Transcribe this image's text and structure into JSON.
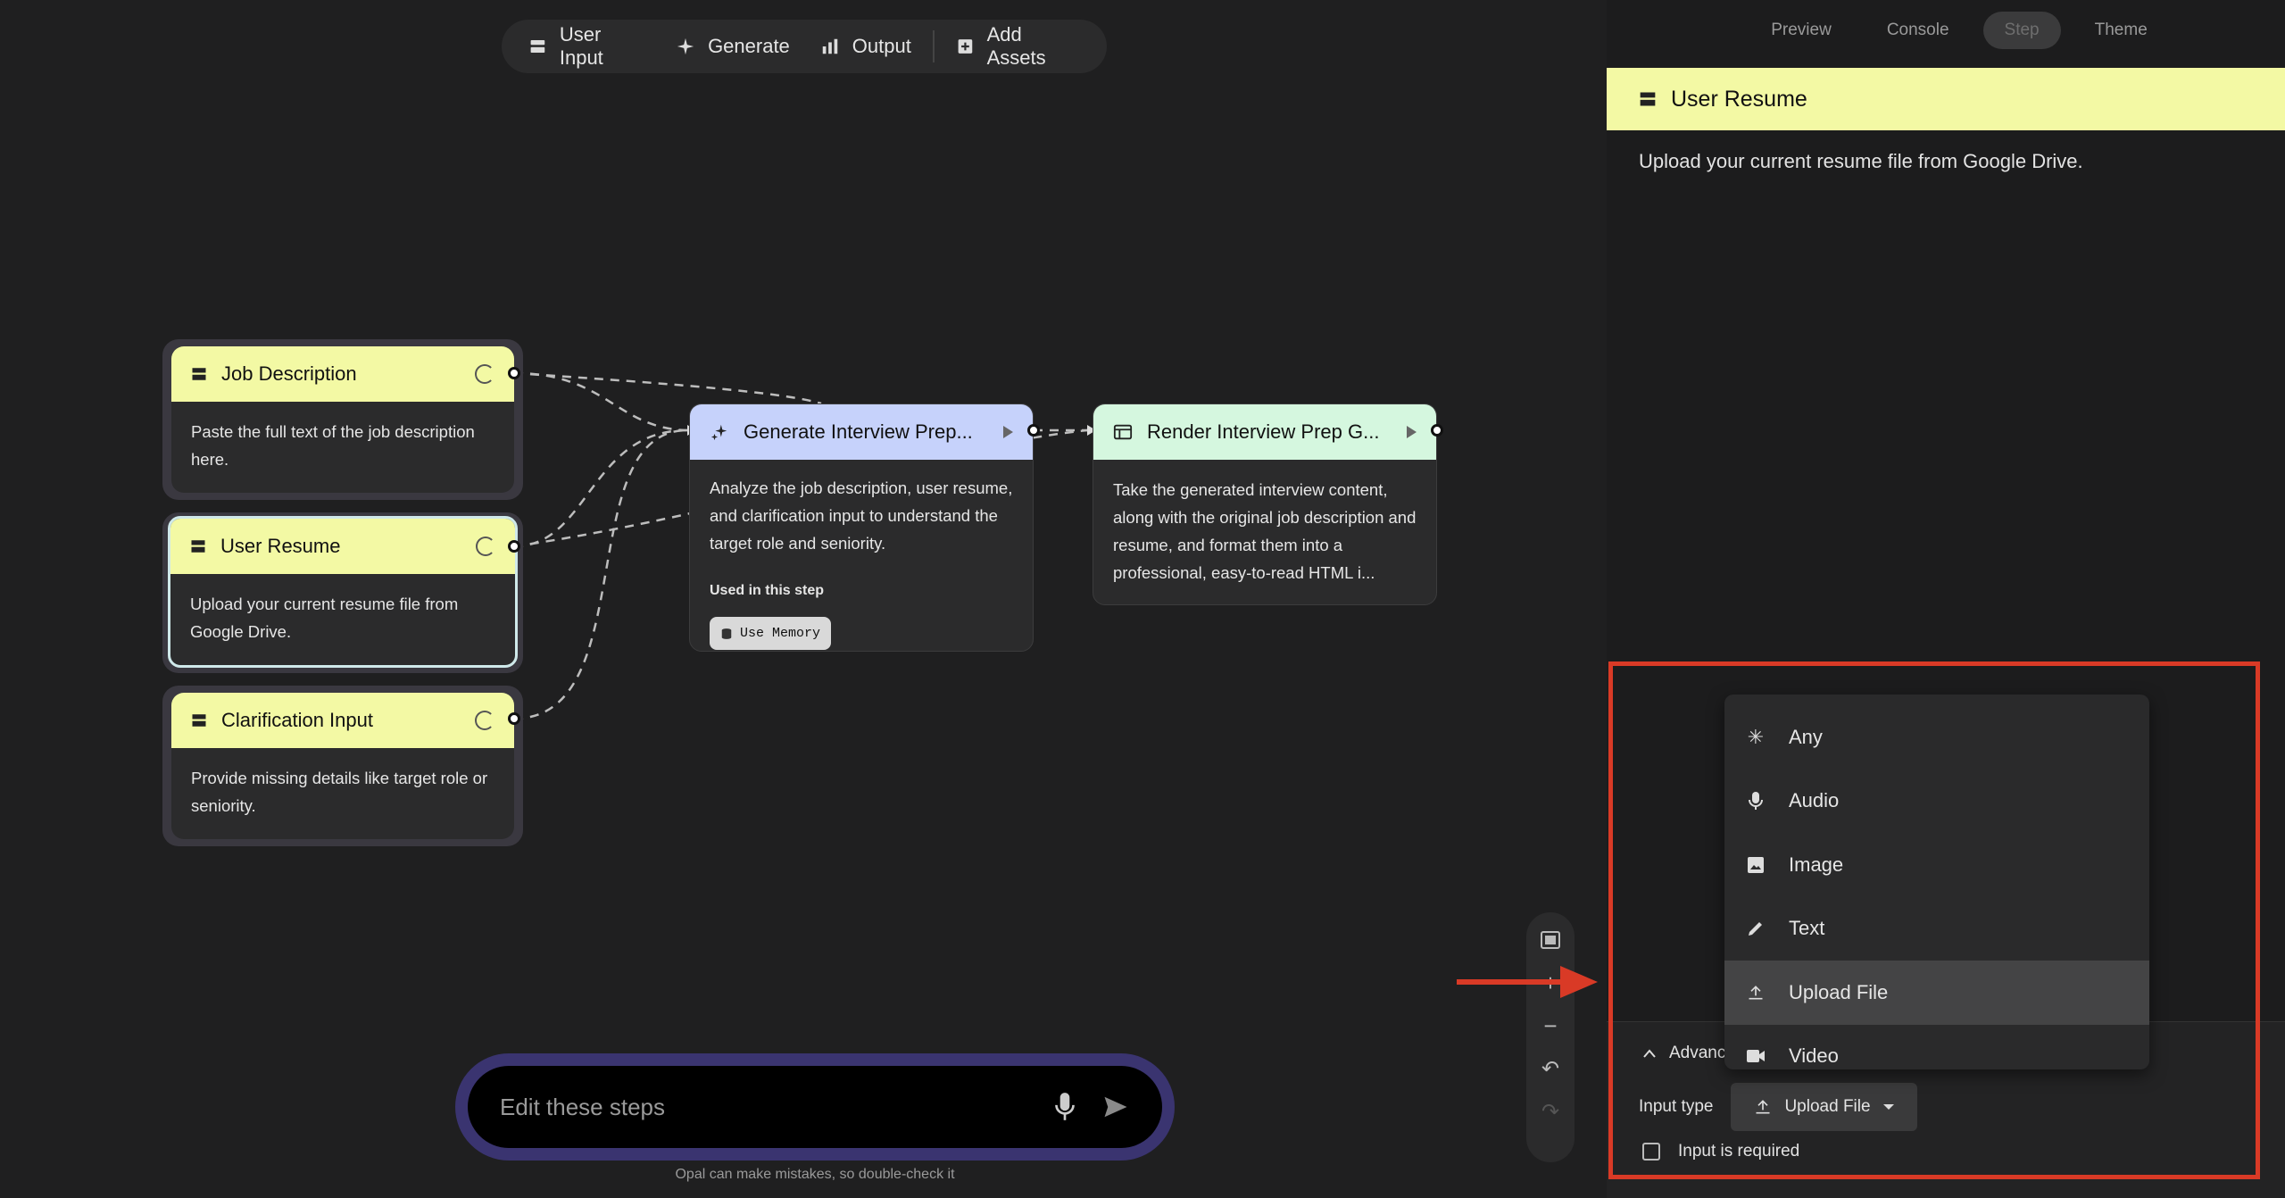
{
  "toolbar": {
    "items": [
      {
        "label": "User Input",
        "icon": "user-input-icon"
      },
      {
        "label": "Generate",
        "icon": "sparkle-icon"
      },
      {
        "label": "Output",
        "icon": "bar-chart-icon"
      },
      {
        "label": "Add Assets",
        "icon": "add-box-icon"
      }
    ]
  },
  "nodes": {
    "job_description": {
      "title": "Job Description",
      "body": "Paste the full text of the job description here."
    },
    "user_resume": {
      "title": "User Resume",
      "body": "Upload your current resume file from Google Drive."
    },
    "clarification": {
      "title": "Clarification Input",
      "body": "Provide missing details like target role or seniority."
    },
    "generate": {
      "title": "Generate Interview Prep...",
      "body": "Analyze the job description, user resume, and clarification input to understand the target role and seniority.",
      "used_label": "Used in this step",
      "chip": "Use Memory"
    },
    "render": {
      "title": "Render Interview Prep G...",
      "body": "Take the generated interview content, along with the original job description and resume, and format them into a professional, easy-to-read HTML i..."
    }
  },
  "prompt": {
    "placeholder": "Edit these steps",
    "disclaimer": "Opal can make mistakes, so double-check it"
  },
  "panel": {
    "tabs": [
      {
        "label": "Preview",
        "active": false
      },
      {
        "label": "Console",
        "active": false
      },
      {
        "label": "Step",
        "active": true
      },
      {
        "label": "Theme",
        "active": false
      }
    ],
    "title": "User Resume",
    "description": "Upload your current resume file from Google Drive.",
    "advanced_label": "Advanc",
    "input_type_label": "Input type",
    "input_type_value": "Upload File",
    "required_label": "Input is required"
  },
  "dropdown": {
    "options": [
      {
        "label": "Any",
        "icon": "asterisk-icon"
      },
      {
        "label": "Audio",
        "icon": "microphone-icon"
      },
      {
        "label": "Image",
        "icon": "image-icon"
      },
      {
        "label": "Text",
        "icon": "pencil-icon"
      },
      {
        "label": "Upload File",
        "icon": "upload-icon",
        "selected": true
      },
      {
        "label": "Video",
        "icon": "video-icon"
      }
    ]
  },
  "colors": {
    "input_node": "#f3f9a4",
    "generate_node": "#c6d2fb",
    "output_node": "#d5f7df",
    "annotation": "#d93a26",
    "prompt_ring": "#3a3470"
  }
}
